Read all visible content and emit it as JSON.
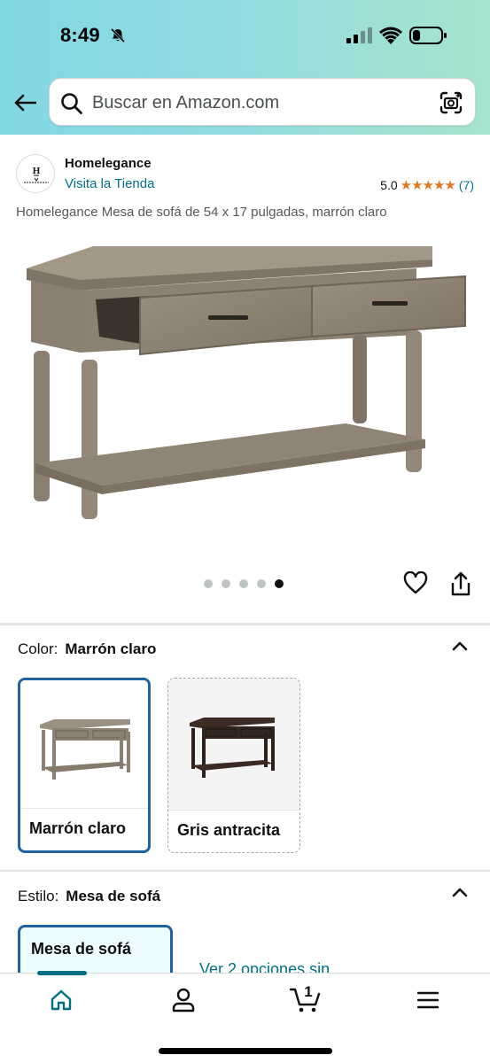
{
  "status_bar": {
    "time": "8:49"
  },
  "search": {
    "placeholder": "Buscar en Amazon.com"
  },
  "seller": {
    "name": "Homelegance",
    "link": "Visita la Tienda",
    "rating_value": "5.0",
    "stars": "★★★★★",
    "rating_count": "(7)"
  },
  "product": {
    "title": "Homelegance Mesa de sofá de 54 x 17 pulgadas, marrón claro",
    "image_count": 5,
    "active_image_index": 4
  },
  "color_section": {
    "label": "Color:",
    "selected": "Marrón claro",
    "options": [
      {
        "label": "Marrón claro",
        "selected": true
      },
      {
        "label": "Gris antracita",
        "selected": false
      }
    ]
  },
  "style_section": {
    "label": "Estilo:",
    "selected": "Mesa de sofá",
    "option_label": "Mesa de sofá",
    "see_more": "Ver 2 opciones sin"
  },
  "cart": {
    "count": "1"
  },
  "colors": {
    "link": "#007185",
    "star": "#de7921",
    "selected_border": "#2162a1",
    "header_gradient_start": "#82d8e3",
    "header_gradient_end": "#a6e4cd"
  }
}
